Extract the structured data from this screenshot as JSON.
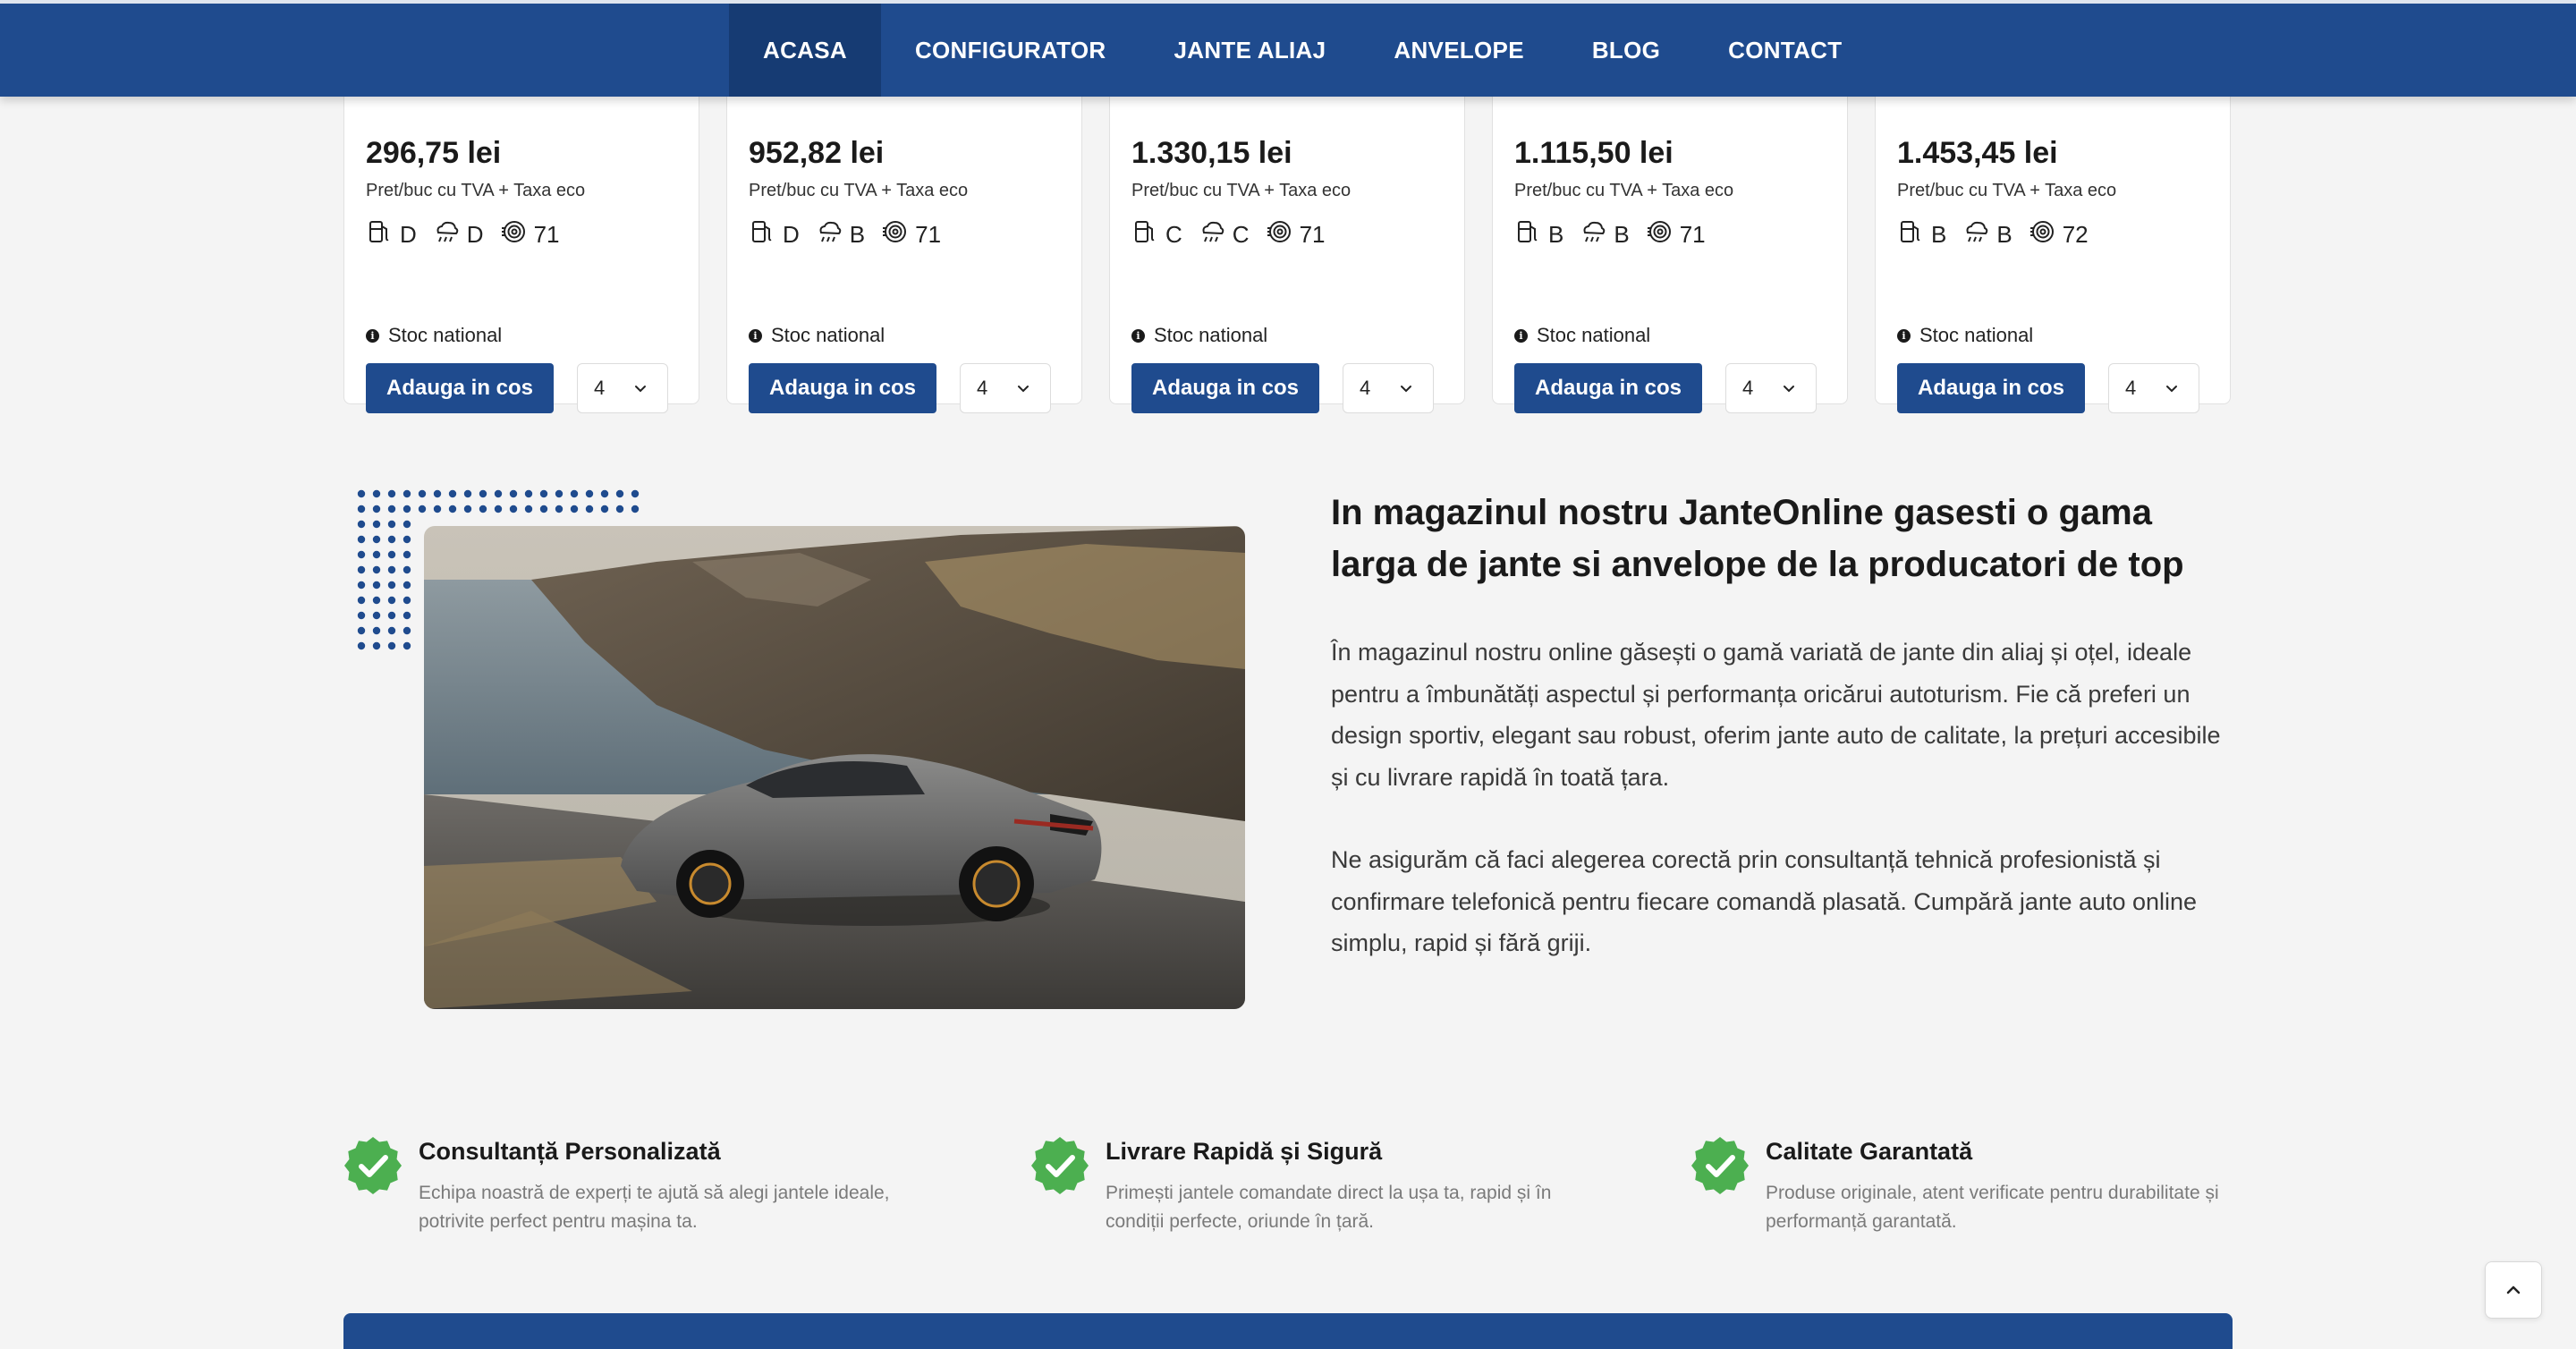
{
  "nav": {
    "items": [
      {
        "label": "ACASA",
        "active": true
      },
      {
        "label": "CONFIGURATOR"
      },
      {
        "label": "JANTE ALIAJ"
      },
      {
        "label": "ANVELOPE"
      },
      {
        "label": "BLOG"
      },
      {
        "label": "CONTACT"
      }
    ]
  },
  "products": [
    {
      "price": "296,75 lei",
      "price_note": "Pret/buc cu TVA + Taxa eco",
      "fuel": "D",
      "wet": "D",
      "noise": "71",
      "stock": "Stoc national",
      "button": "Adauga in cos",
      "qty": "4",
      "tire_visible": false
    },
    {
      "price": "952,82 lei",
      "price_note": "Pret/buc cu TVA + Taxa eco",
      "fuel": "D",
      "wet": "B",
      "noise": "71",
      "stock": "Stoc national",
      "button": "Adauga in cos",
      "qty": "4",
      "tire_visible": false
    },
    {
      "price": "1.330,15 lei",
      "price_note": "Pret/buc cu TVA + Taxa eco",
      "fuel": "C",
      "wet": "C",
      "noise": "71",
      "stock": "Stoc national",
      "button": "Adauga in cos",
      "qty": "4",
      "tire_visible": true
    },
    {
      "price": "1.115,50 lei",
      "price_note": "Pret/buc cu TVA + Taxa eco",
      "fuel": "B",
      "wet": "B",
      "noise": "71",
      "stock": "Stoc national",
      "button": "Adauga in cos",
      "qty": "4",
      "tire_visible": false
    },
    {
      "price": "1.453,45 lei",
      "price_note": "Pret/buc cu TVA + Taxa eco",
      "fuel": "B",
      "wet": "B",
      "noise": "72",
      "stock": "Stoc national",
      "button": "Adauga in cos",
      "qty": "4",
      "tire_visible": true
    }
  ],
  "about": {
    "title": "In magazinul nostru JanteOnline gasesti o gama larga de jante si anvelope de la producatori de top",
    "paragraph1": "În magazinul nostru online găsești o gamă variată de jante din aliaj și oțel, ideale pentru a îmbunătăți aspectul și performanța oricărui autoturism. Fie că preferi un design sportiv, elegant sau robust, oferim jante auto de calitate, la prețuri accesibile și cu livrare rapidă în toată țara.",
    "paragraph2": "Ne asigurăm că faci alegerea corectă prin consultanță tehnică profesionistă și confirmare telefonică pentru fiecare comandă plasată. Cumpără jante auto online simplu, rapid și fără griji."
  },
  "features": [
    {
      "title": "Consultanță Personalizată",
      "desc": "Echipa noastră de experți te ajută să alegi jantele ideale, potrivite perfect pentru mașina ta."
    },
    {
      "title": "Livrare Rapidă și Sigură",
      "desc": "Primești jantele comandate direct la ușa ta, rapid și în condiții perfecte, oriunde în țară."
    },
    {
      "title": "Calitate Garantată",
      "desc": "Produse originale, atent verificate pentru durabilitate și performanță garantată."
    }
  ],
  "colors": {
    "brand": "#1f4b8e",
    "nav_active": "#163b73",
    "badge_green": "#4caf50",
    "background": "#f4f4f4"
  },
  "icons": {
    "fuel": "fuel-efficiency-icon",
    "wet": "wet-grip-icon",
    "noise": "noise-level-icon",
    "stock": "info-icon",
    "qty": "chevron-down-icon",
    "feature": "check-badge-icon",
    "scroll_top": "chevron-up-icon"
  }
}
